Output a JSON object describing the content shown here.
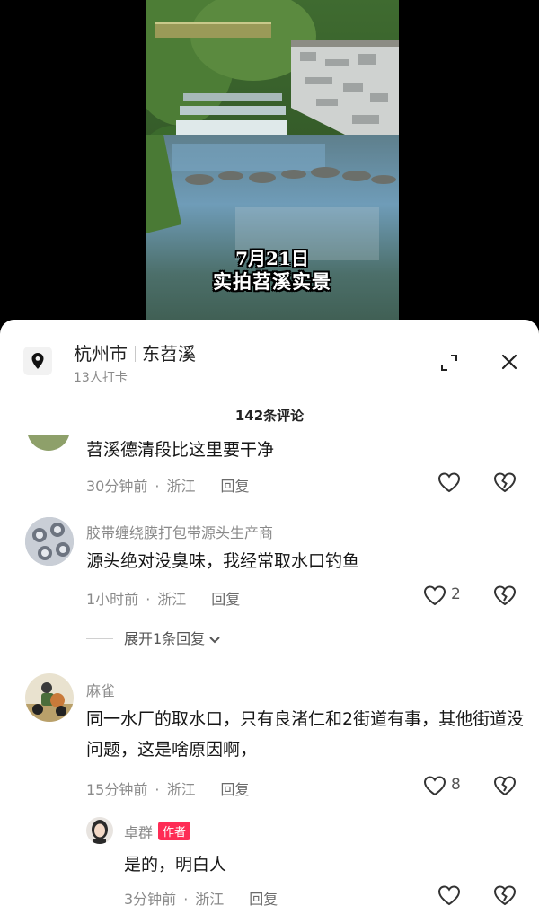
{
  "video": {
    "caption_line1": "7月21日",
    "caption_line2": "实拍苕溪实景"
  },
  "location": {
    "city": "杭州市",
    "place": "东苕溪",
    "checkins": "13人打卡",
    "pin_icon": "location-pin-icon",
    "collapse_icon": "collapse-arrows-icon",
    "close_icon": "close-icon"
  },
  "comment_count": "142条评论",
  "comments": [
    {
      "text": "苕溪德清段比这里要干净",
      "time": "30分钟前",
      "region": "浙江",
      "reply": "回复",
      "likes": ""
    },
    {
      "username": "胶带缠绕膜打包带源头生产商",
      "text": "源头绝对没臭味，我经常取水口钓鱼",
      "time": "1小时前",
      "region": "浙江",
      "reply": "回复",
      "likes": "2",
      "expand": "展开1条回复"
    },
    {
      "username": "麻雀",
      "text": "同一水厂的取水口，只有良渚仁和2街道有事，其他街道没问题，这是啥原因啊，",
      "time": "15分钟前",
      "region": "浙江",
      "reply": "回复",
      "likes": "8",
      "reply_item": {
        "username": "卓群",
        "badge": "作者",
        "text": "是的，明白人",
        "time": "3分钟前",
        "region": "浙江",
        "reply": "回复",
        "likes": ""
      }
    }
  ],
  "colors": {
    "author_badge": "#fe2c55",
    "secondary_text": "#8a8a8a",
    "primary_text": "#161616"
  }
}
